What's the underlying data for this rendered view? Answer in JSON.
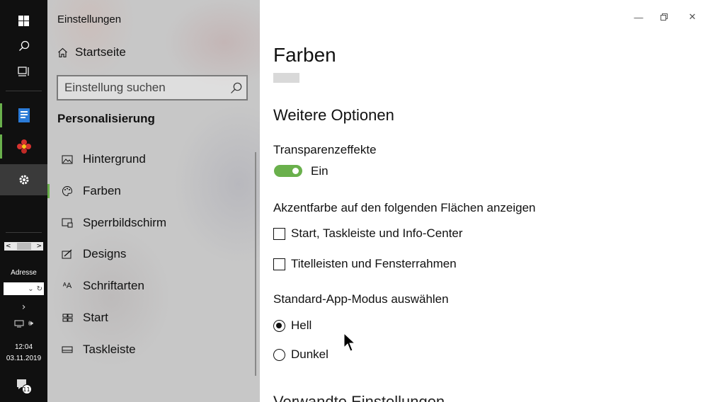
{
  "taskbar": {
    "address_label": "Adresse",
    "time": "12:04",
    "date": "03.11.2019",
    "notification_count": "11"
  },
  "sidebar": {
    "app_title": "Einstellungen",
    "home_label": "Startseite",
    "search_placeholder": "Einstellung suchen",
    "section_title": "Personalisierung",
    "items": [
      {
        "label": "Hintergrund",
        "icon": "picture-icon"
      },
      {
        "label": "Farben",
        "icon": "palette-icon",
        "selected": true
      },
      {
        "label": "Sperrbildschirm",
        "icon": "lock-screen-icon"
      },
      {
        "label": "Designs",
        "icon": "brush-icon"
      },
      {
        "label": "Schriftarten",
        "icon": "font-icon"
      },
      {
        "label": "Start",
        "icon": "start-tiles-icon"
      },
      {
        "label": "Taskleiste",
        "icon": "taskbar-icon"
      }
    ]
  },
  "main": {
    "title": "Farben",
    "more_options_title": "Weitere Optionen",
    "transparency_label": "Transparenzeffekte",
    "transparency_state": "Ein",
    "accent_label": "Akzentfarbe auf den folgenden Flächen anzeigen",
    "checkbox_start": "Start, Taskleiste und Info-Center",
    "checkbox_titlebars": "Titelleisten und Fensterrahmen",
    "app_mode_label": "Standard-App-Modus auswählen",
    "radio_light": "Hell",
    "radio_dark": "Dunkel",
    "related_cutoff": "Verwandte Einstellungen"
  },
  "colors": {
    "accent": "#6ab04c",
    "taskbar": "#101010"
  }
}
